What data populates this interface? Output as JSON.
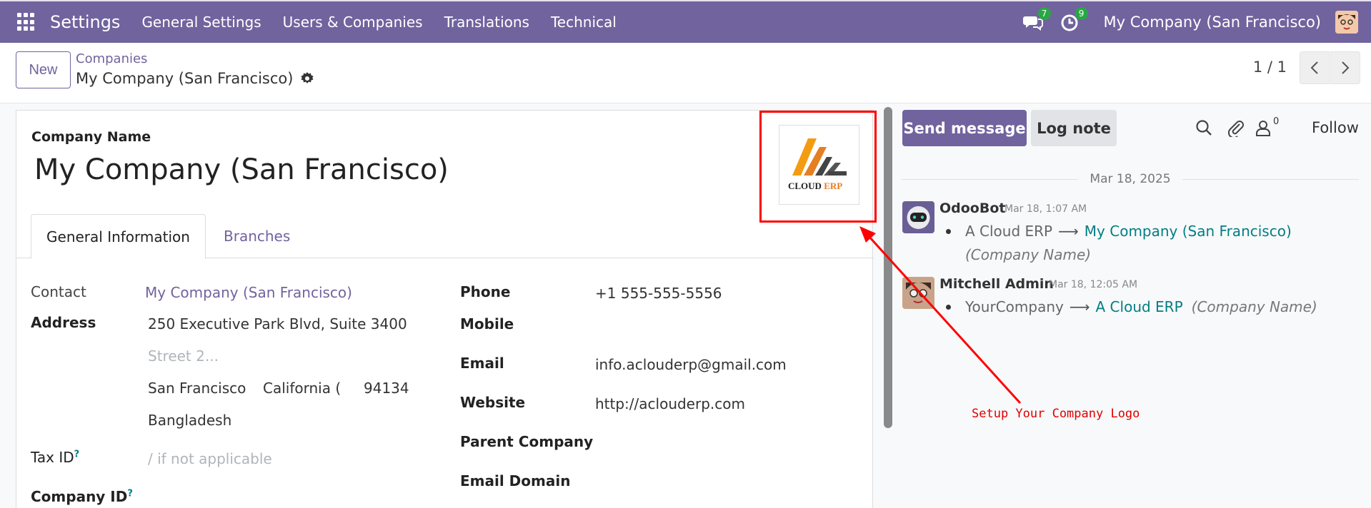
{
  "navbar": {
    "app_name": "Settings",
    "menu": [
      "General Settings",
      "Users & Companies",
      "Translations",
      "Technical"
    ],
    "messages_badge": "7",
    "activities_badge": "9",
    "company_switcher": "My Company (San Francisco)"
  },
  "control": {
    "new_label": "New",
    "breadcrumb_parent": "Companies",
    "breadcrumb_current": "My Company (San Francisco)",
    "pager": "1 / 1"
  },
  "form": {
    "company_name_label": "Company Name",
    "company_name": "My Company (San Francisco)",
    "logo_text": "CLOUD ERP",
    "tabs": [
      "General Information",
      "Branches"
    ],
    "contact_label": "Contact",
    "contact_value": "My Company (San Francisco)",
    "address_label": "Address",
    "street": "250 Executive Park Blvd, Suite 3400",
    "street2_placeholder": "Street 2...",
    "city": "San Francisco",
    "state": "California (U",
    "zip": "94134",
    "country": "Bangladesh",
    "tax_id_label": "Tax ID",
    "tax_id_placeholder": "/ if not applicable",
    "company_id_label": "Company ID",
    "help_mark": "?",
    "phone_label": "Phone",
    "phone_value": "+1 555-555-5556",
    "mobile_label": "Mobile",
    "email_label": "Email",
    "email_value": "info.aclouderp@gmail.com",
    "website_label": "Website",
    "website_value": "http://aclouderp.com",
    "parent_company_label": "Parent Company",
    "email_domain_label": "Email Domain"
  },
  "chatter": {
    "send_message": "Send message",
    "log_note": "Log note",
    "followers_count": "0",
    "follow": "Follow",
    "date": "Mar 18, 2025",
    "messages": [
      {
        "author": "OdooBot",
        "time": "Mar 18, 1:07 AM",
        "from": "A Cloud ERP",
        "to": "My Company (San Francisco)",
        "field": "(Company Name)"
      },
      {
        "author": "Mitchell Admin",
        "time": "Mar 18, 12:05 AM",
        "from": "YourCompany",
        "to": "A Cloud ERP",
        "field": "(Company Name)"
      }
    ]
  },
  "annotation": {
    "text": "Setup Your Company Logo",
    "color": "#ff0000"
  },
  "colors": {
    "brand": "#71639e",
    "link_teal": "#017e84",
    "badge_green": "#28a745"
  }
}
